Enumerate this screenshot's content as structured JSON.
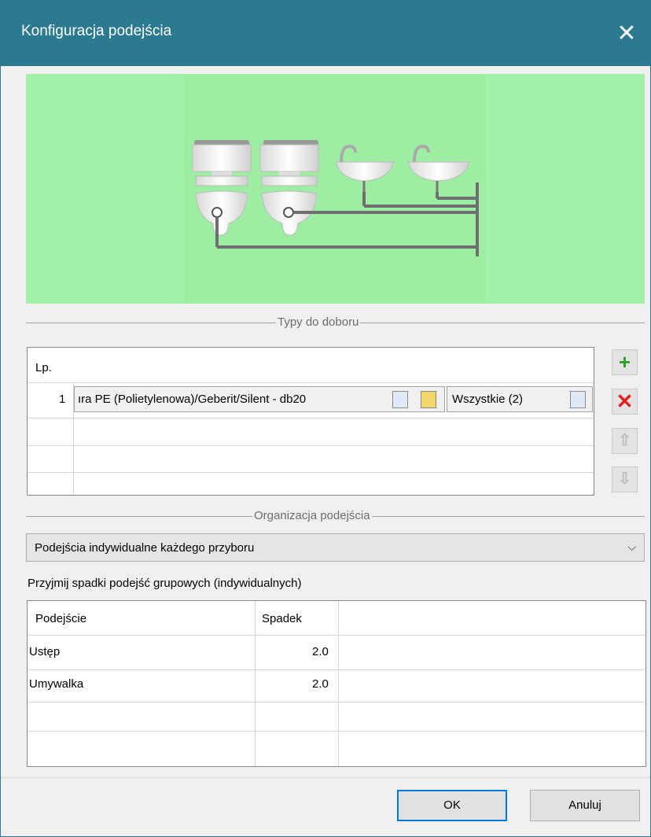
{
  "window": {
    "title": "Konfiguracja podejścia",
    "close_glyph": "✕"
  },
  "sections": {
    "types": "Typy do doboru",
    "organization": "Organizacja podejścia"
  },
  "types_grid": {
    "header_lp": "Lp.",
    "rows": [
      {
        "lp": "1",
        "pipe": "ıra PE (Polietylenowa)/Geberit/Silent - db20",
        "fixtures": "Wszystkie (2)"
      }
    ]
  },
  "side_buttons": {
    "add": "add-icon",
    "delete": "delete-icon",
    "up": "arrow-up-icon",
    "down": "arrow-down-icon"
  },
  "organization": {
    "selected": "Podejścia indywidualne każdego przyboru"
  },
  "slopes": {
    "label": "Przyjmij spadki podejść grupowych (indywidualnych)",
    "columns": [
      "Podejście",
      "Spadek"
    ],
    "rows": [
      {
        "name": "Ustęp",
        "value": "2.0"
      },
      {
        "name": "Umywalka",
        "value": "2.0"
      }
    ]
  },
  "buttons": {
    "ok": "OK",
    "cancel": "Anuluj"
  },
  "colors": {
    "titlebar": "#2b7a90",
    "preview_bg": "#a3f0a9",
    "accent": "#0078d7"
  }
}
